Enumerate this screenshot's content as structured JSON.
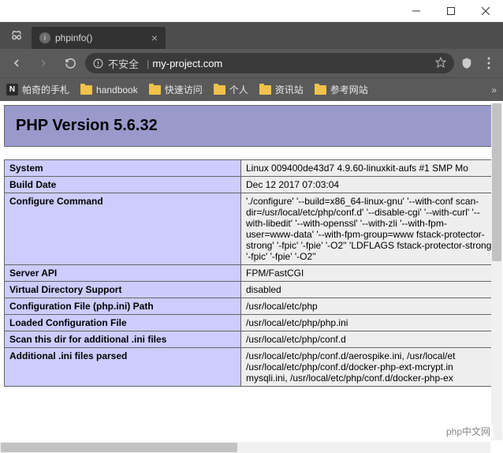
{
  "window": {
    "minimize": "—",
    "maximize": "□",
    "close": "✕"
  },
  "tab": {
    "favicon_letter": "i",
    "title": "phpinfo()",
    "close": "×"
  },
  "addr": {
    "security_text": "不安全",
    "url": "my-project.com"
  },
  "bookmarks": {
    "items": [
      {
        "type": "n",
        "label": "帕奇的手札"
      },
      {
        "type": "folder",
        "label": "handbook"
      },
      {
        "type": "folder",
        "label": "快速访问"
      },
      {
        "type": "folder",
        "label": "个人"
      },
      {
        "type": "folder",
        "label": "资讯站"
      },
      {
        "type": "folder",
        "label": "参考网站"
      }
    ]
  },
  "phpinfo": {
    "header": "PHP Version 5.6.32",
    "rows": [
      {
        "key": "System",
        "val": "Linux 009400de43d7 4.9.60-linuxkit-aufs #1 SMP Mo"
      },
      {
        "key": "Build Date",
        "val": "Dec 12 2017 07:03:04"
      },
      {
        "key": "Configure Command",
        "val": "'./configure' '--build=x86_64-linux-gnu' '--with-conf scan-dir=/usr/local/etc/php/conf.d' '--disable-cgi' '--with-curl' '--with-libedit' '--with-openssl' '--with-zli '--with-fpm-user=www-data' '--with-fpm-group=www fstack-protector-strong' '-fpic' '-fpie' '-O2'' 'LDFLAGS fstack-protector-strong' '-fpic' '-fpie' '-O2''",
        "wrap": true
      },
      {
        "key": "Server API",
        "val": "FPM/FastCGI"
      },
      {
        "key": "Virtual Directory Support",
        "val": "disabled"
      },
      {
        "key": "Configuration File (php.ini) Path",
        "val": "/usr/local/etc/php"
      },
      {
        "key": "Loaded Configuration File",
        "val": "/usr/local/etc/php/php.ini"
      },
      {
        "key": "Scan this dir for additional .ini files",
        "val": "/usr/local/etc/php/conf.d"
      },
      {
        "key": "Additional .ini files parsed",
        "val": "/usr/local/etc/php/conf.d/aerospike.ini, /usr/local/et /usr/local/etc/php/conf.d/docker-php-ext-mcrypt.in mysqli.ini, /usr/local/etc/php/conf.d/docker-php-ex",
        "wrap": true
      }
    ]
  },
  "watermark": "php中文网"
}
